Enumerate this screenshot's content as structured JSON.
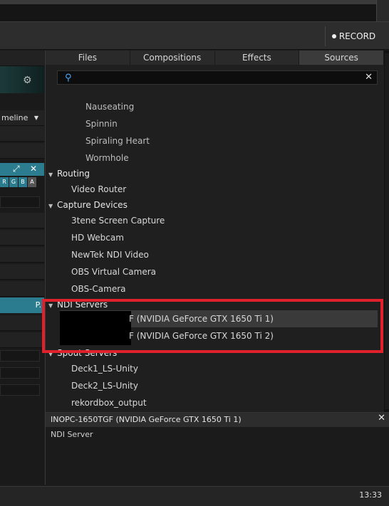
{
  "header": {
    "record_label": "RECORD"
  },
  "left": {
    "timeline_label": "meline",
    "p_label": "P."
  },
  "tabs": [
    {
      "label": "Files"
    },
    {
      "label": "Compositions"
    },
    {
      "label": "Effects"
    },
    {
      "label": "Sources",
      "active": true
    }
  ],
  "search": {
    "value": "",
    "placeholder": ""
  },
  "list": [
    {
      "label": "Nauseating",
      "level": 2
    },
    {
      "label": "Spinnin",
      "level": 2
    },
    {
      "label": "Spiraling Heart",
      "level": 2
    },
    {
      "label": "Wormhole",
      "level": 2
    },
    {
      "label": "Routing",
      "level": 0
    },
    {
      "label": "Video Router",
      "level": 1
    },
    {
      "label": "Capture Devices",
      "level": 0
    },
    {
      "label": "3tene Screen Capture",
      "level": 1
    },
    {
      "label": "HD Webcam",
      "level": 1
    },
    {
      "label": "NewTek NDI Video",
      "level": 1
    },
    {
      "label": "OBS Virtual Camera",
      "level": 1
    },
    {
      "label": "OBS-Camera",
      "level": 1
    },
    {
      "label": "NDI Servers",
      "level": 0
    },
    {
      "label": "F (NVIDIA GeForce GTX 1650 Ti 1)",
      "level": 1,
      "selected": true
    },
    {
      "label": "F (NVIDIA GeForce GTX 1650 Ti 2)",
      "level": 1
    },
    {
      "label": "Spout Servers",
      "level": 0
    },
    {
      "label": "Deck1_LS-Unity",
      "level": 1
    },
    {
      "label": "Deck2_LS-Unity",
      "level": 1
    },
    {
      "label": "rekordbox_output",
      "level": 1
    }
  ],
  "info": {
    "title": "INOPC-1650TGF (NVIDIA GeForce GTX 1650 Ti 1)",
    "description": "NDI Server"
  },
  "status": {
    "clock": "13:33"
  },
  "colors": {
    "accent": "#2b7c8f",
    "highlight": "#e0202a",
    "search_icon": "#4aa9ff"
  },
  "icons": [
    "gear-icon",
    "search-icon",
    "close-icon",
    "record-dot-icon",
    "expand-icon"
  ]
}
